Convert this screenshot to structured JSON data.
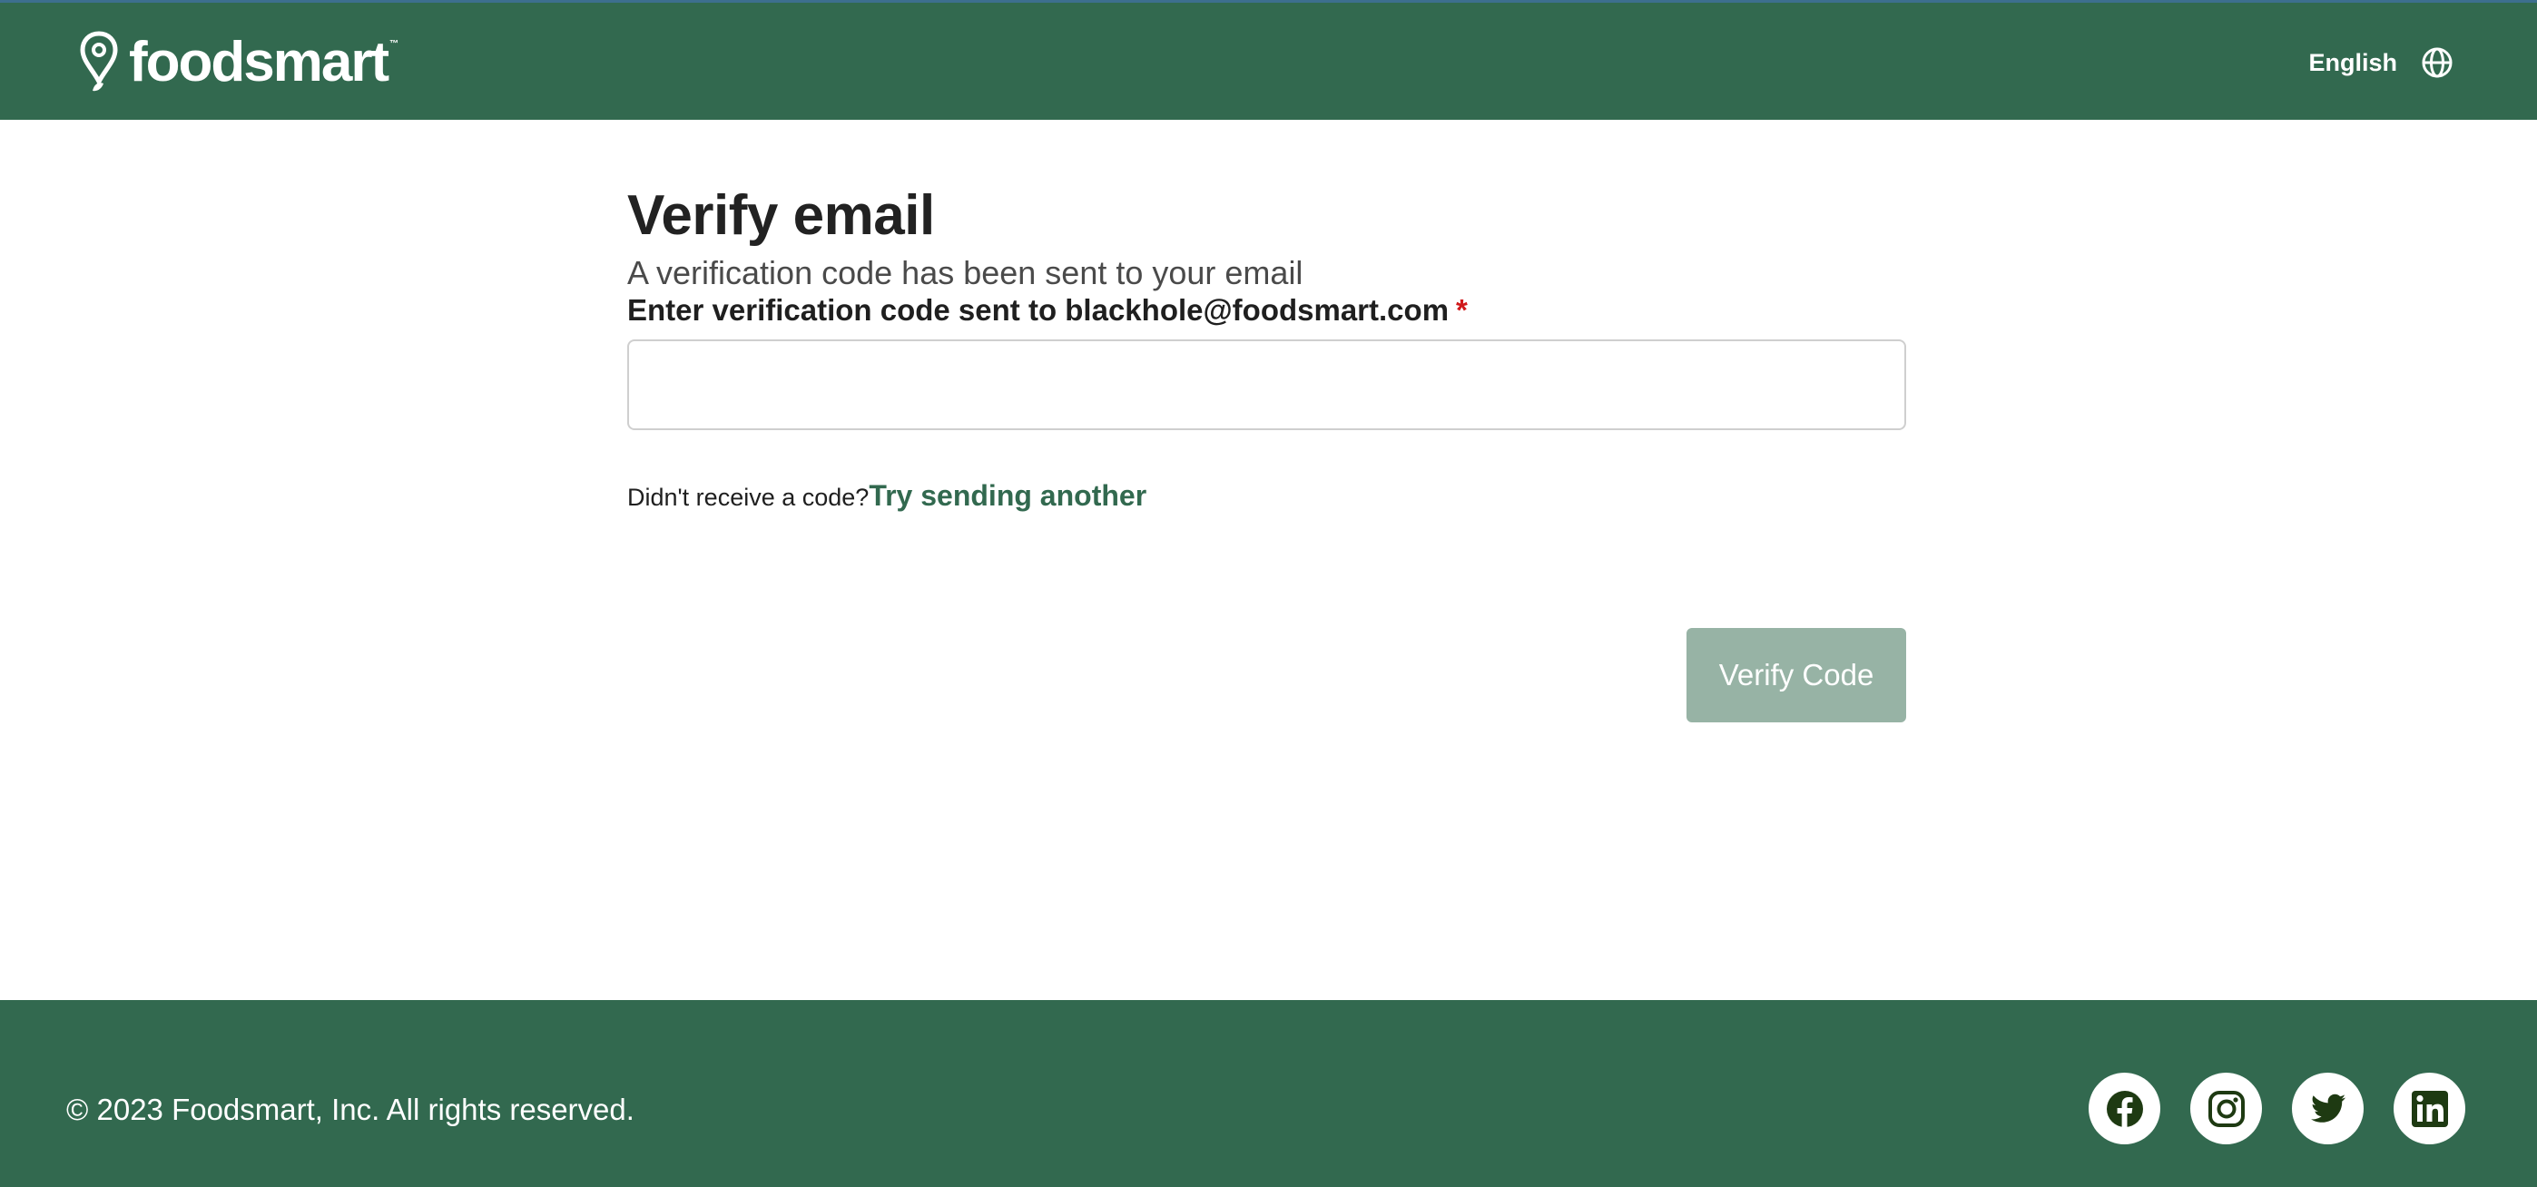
{
  "header": {
    "logo_text": "foodsmart",
    "logo_tm": "™",
    "language_label": "English",
    "language_icon": "globe-icon"
  },
  "main": {
    "title": "Verify email",
    "subtitle": "A verification code has been sent to your email",
    "field_label": "Enter verification code sent to blackhole@foodsmart.com",
    "required_mark": "*",
    "code_value": "",
    "resend_prompt": "Didn't receive a code?",
    "resend_link": "Try sending another",
    "verify_button": "Verify Code"
  },
  "footer": {
    "copyright": "© 2023 Foodsmart, Inc. All rights reserved.",
    "social_icons": [
      "facebook-icon",
      "instagram-icon",
      "twitter-icon",
      "linkedin-icon"
    ]
  },
  "colors": {
    "brand_green": "#32694f",
    "button_disabled": "#97b3a5",
    "required_red": "#d0191b",
    "social_icon_dark": "#1e3a12"
  }
}
